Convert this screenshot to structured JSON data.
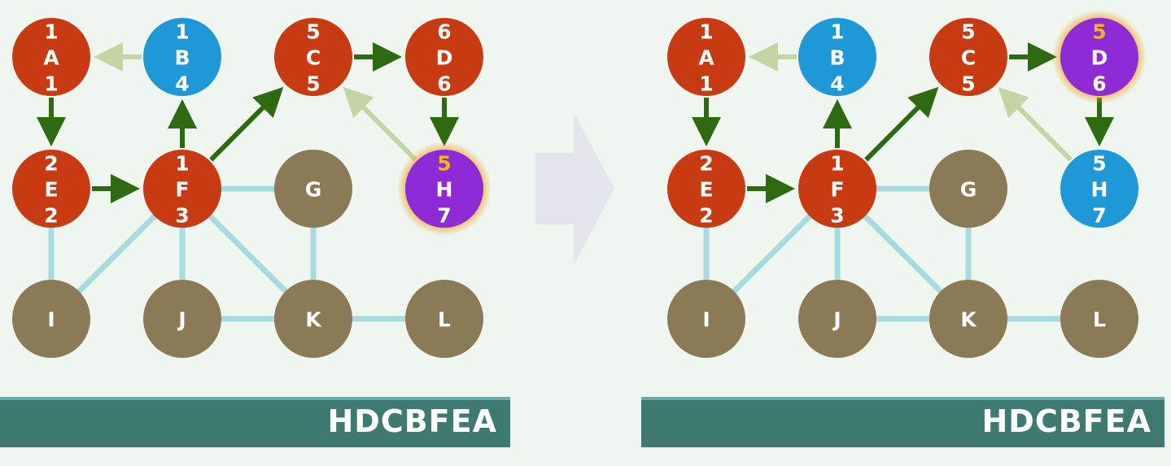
{
  "colors": {
    "visited": "#c83a12",
    "finished": "#1e98d6",
    "current": "#8e2bd6",
    "unvisited": "#8a7a55",
    "current_glow": "#f0a020",
    "highlight_number": "#f7b21a",
    "tree_edge": "#2e6a10",
    "back_edge": "#c2d6a4",
    "plain_edge": "#a8dbe0",
    "stack_bar": "#3f7a72"
  },
  "transition_arrow": {
    "icon": "right-arrow-icon",
    "color": "#e4e5ec"
  },
  "panels": [
    {
      "id": "before",
      "stack_text": "HDCBFEA",
      "nodes": [
        {
          "id": "A",
          "letter": "A",
          "top": "1",
          "bottom": "1",
          "state": "visited",
          "highlight_top": false
        },
        {
          "id": "B",
          "letter": "B",
          "top": "1",
          "bottom": "4",
          "state": "finished",
          "highlight_top": false
        },
        {
          "id": "C",
          "letter": "C",
          "top": "5",
          "bottom": "5",
          "state": "visited",
          "highlight_top": false
        },
        {
          "id": "D",
          "letter": "D",
          "top": "6",
          "bottom": "6",
          "state": "visited",
          "highlight_top": false
        },
        {
          "id": "E",
          "letter": "E",
          "top": "2",
          "bottom": "2",
          "state": "visited",
          "highlight_top": false
        },
        {
          "id": "F",
          "letter": "F",
          "top": "1",
          "bottom": "3",
          "state": "visited",
          "highlight_top": false
        },
        {
          "id": "G",
          "letter": "G",
          "top": "",
          "bottom": "",
          "state": "unvisited",
          "highlight_top": false
        },
        {
          "id": "H",
          "letter": "H",
          "top": "5",
          "bottom": "7",
          "state": "current",
          "highlight_top": true
        },
        {
          "id": "I",
          "letter": "I",
          "top": "",
          "bottom": "",
          "state": "unvisited",
          "highlight_top": false
        },
        {
          "id": "J",
          "letter": "J",
          "top": "",
          "bottom": "",
          "state": "unvisited",
          "highlight_top": false
        },
        {
          "id": "K",
          "letter": "K",
          "top": "",
          "bottom": "",
          "state": "unvisited",
          "highlight_top": false
        },
        {
          "id": "L",
          "letter": "L",
          "top": "",
          "bottom": "",
          "state": "unvisited",
          "highlight_top": false
        }
      ],
      "edges": [
        {
          "from": "B",
          "to": "A",
          "kind": "back"
        },
        {
          "from": "A",
          "to": "E",
          "kind": "tree"
        },
        {
          "from": "E",
          "to": "F",
          "kind": "tree"
        },
        {
          "from": "F",
          "to": "B",
          "kind": "tree"
        },
        {
          "from": "F",
          "to": "C",
          "kind": "tree"
        },
        {
          "from": "C",
          "to": "D",
          "kind": "tree"
        },
        {
          "from": "D",
          "to": "H",
          "kind": "tree"
        },
        {
          "from": "H",
          "to": "C",
          "kind": "back"
        },
        {
          "from": "F",
          "to": "G",
          "kind": "plain"
        },
        {
          "from": "E",
          "to": "I",
          "kind": "plain"
        },
        {
          "from": "F",
          "to": "I",
          "kind": "plain"
        },
        {
          "from": "F",
          "to": "J",
          "kind": "plain"
        },
        {
          "from": "F",
          "to": "K",
          "kind": "plain"
        },
        {
          "from": "G",
          "to": "K",
          "kind": "plain"
        },
        {
          "from": "J",
          "to": "K",
          "kind": "plain"
        },
        {
          "from": "K",
          "to": "L",
          "kind": "plain"
        }
      ]
    },
    {
      "id": "after",
      "stack_text": "HDCBFEA",
      "nodes": [
        {
          "id": "A",
          "letter": "A",
          "top": "1",
          "bottom": "1",
          "state": "visited",
          "highlight_top": false
        },
        {
          "id": "B",
          "letter": "B",
          "top": "1",
          "bottom": "4",
          "state": "finished",
          "highlight_top": false
        },
        {
          "id": "C",
          "letter": "C",
          "top": "5",
          "bottom": "5",
          "state": "visited",
          "highlight_top": false
        },
        {
          "id": "D",
          "letter": "D",
          "top": "5",
          "bottom": "6",
          "state": "current",
          "highlight_top": true
        },
        {
          "id": "E",
          "letter": "E",
          "top": "2",
          "bottom": "2",
          "state": "visited",
          "highlight_top": false
        },
        {
          "id": "F",
          "letter": "F",
          "top": "1",
          "bottom": "3",
          "state": "visited",
          "highlight_top": false
        },
        {
          "id": "G",
          "letter": "G",
          "top": "",
          "bottom": "",
          "state": "unvisited",
          "highlight_top": false
        },
        {
          "id": "H",
          "letter": "H",
          "top": "5",
          "bottom": "7",
          "state": "finished",
          "highlight_top": false
        },
        {
          "id": "I",
          "letter": "I",
          "top": "",
          "bottom": "",
          "state": "unvisited",
          "highlight_top": false
        },
        {
          "id": "J",
          "letter": "J",
          "top": "",
          "bottom": "",
          "state": "unvisited",
          "highlight_top": false
        },
        {
          "id": "K",
          "letter": "K",
          "top": "",
          "bottom": "",
          "state": "unvisited",
          "highlight_top": false
        },
        {
          "id": "L",
          "letter": "L",
          "top": "",
          "bottom": "",
          "state": "unvisited",
          "highlight_top": false
        }
      ],
      "edges": [
        {
          "from": "B",
          "to": "A",
          "kind": "back"
        },
        {
          "from": "A",
          "to": "E",
          "kind": "tree"
        },
        {
          "from": "E",
          "to": "F",
          "kind": "tree"
        },
        {
          "from": "F",
          "to": "B",
          "kind": "tree"
        },
        {
          "from": "F",
          "to": "C",
          "kind": "tree"
        },
        {
          "from": "C",
          "to": "D",
          "kind": "tree"
        },
        {
          "from": "D",
          "to": "H",
          "kind": "tree"
        },
        {
          "from": "H",
          "to": "C",
          "kind": "back"
        },
        {
          "from": "F",
          "to": "G",
          "kind": "plain"
        },
        {
          "from": "E",
          "to": "I",
          "kind": "plain"
        },
        {
          "from": "F",
          "to": "I",
          "kind": "plain"
        },
        {
          "from": "F",
          "to": "J",
          "kind": "plain"
        },
        {
          "from": "F",
          "to": "K",
          "kind": "plain"
        },
        {
          "from": "G",
          "to": "K",
          "kind": "plain"
        },
        {
          "from": "J",
          "to": "K",
          "kind": "plain"
        },
        {
          "from": "K",
          "to": "L",
          "kind": "plain"
        }
      ]
    }
  ]
}
